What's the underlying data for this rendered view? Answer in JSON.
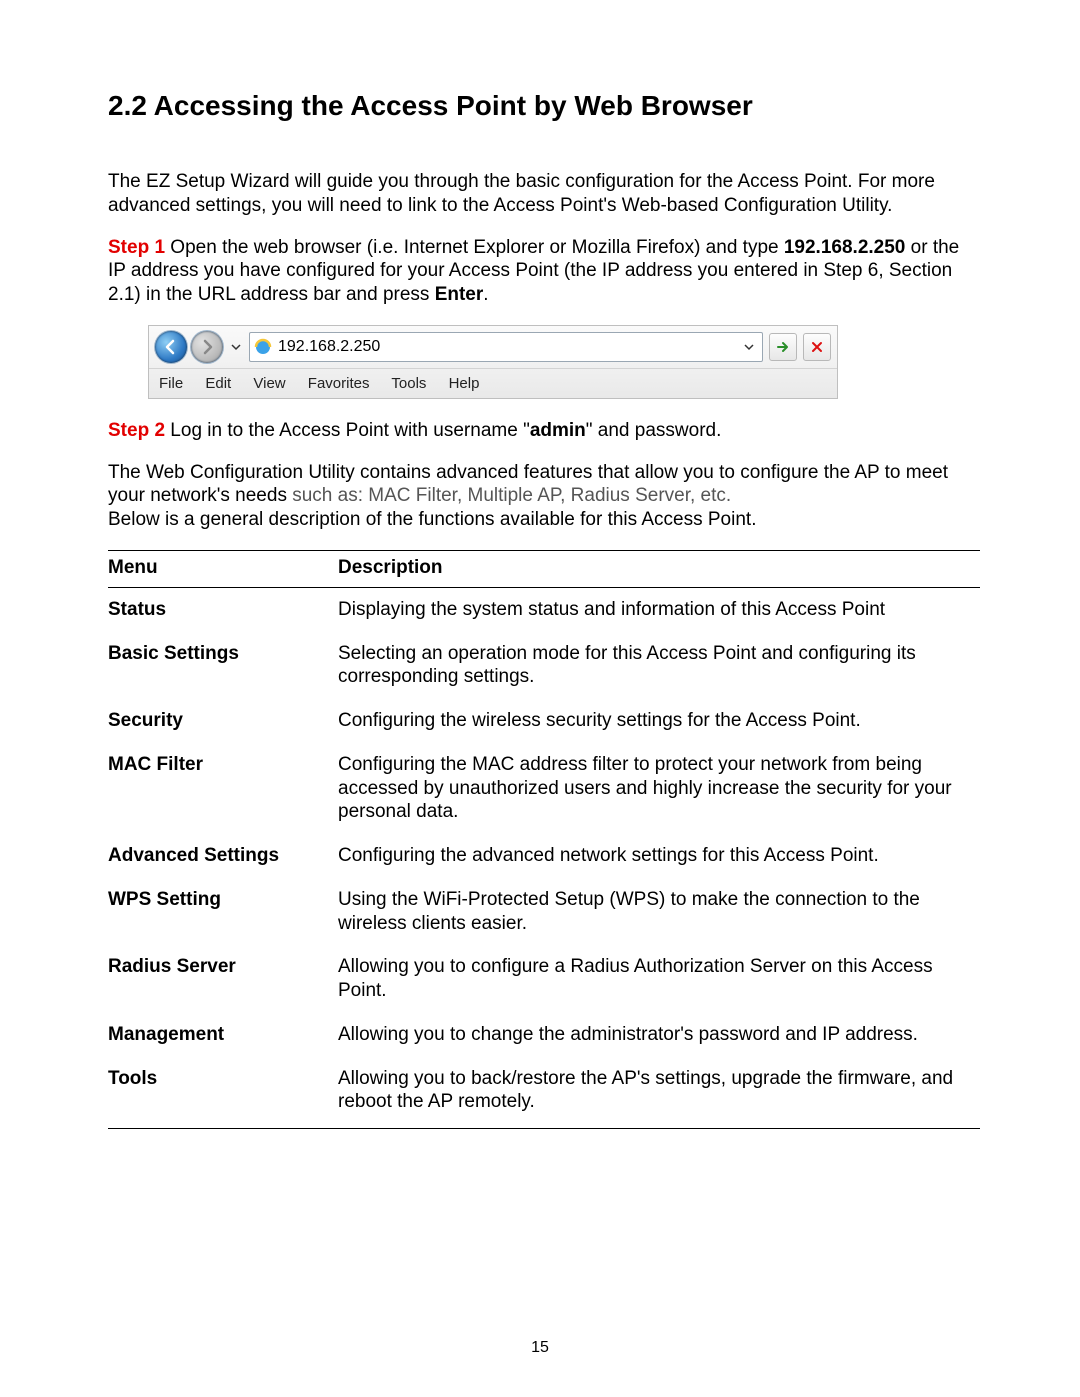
{
  "heading": "2.2 Accessing the Access Point by Web Browser",
  "intro": "The EZ Setup Wizard will guide you through the basic configuration for the Access Point. For more advanced settings, you will need to link to the Access Point's Web-based Configuration Utility.",
  "step1": {
    "label": "Step 1",
    "text_a": " Open the web browser (i.e. Internet Explorer or Mozilla Firefox) and type ",
    "ip": "192.168.2.250",
    "text_b": " or the IP address you have configured for your Access Point (the IP address you entered in Step 6, Section 2.1) in the URL address bar and press ",
    "enter": "Enter",
    "period": "."
  },
  "browser": {
    "address_value": "192.168.2.250",
    "menu_file": "File",
    "menu_edit": "Edit",
    "menu_view": "View",
    "menu_favorites": "Favorites",
    "menu_tools": "Tools",
    "menu_help": "Help"
  },
  "step2": {
    "label": "Step 2",
    "text_a": " Log in to the Access Point with username \"",
    "admin": "admin",
    "text_b": "\" and password."
  },
  "para3_a": "The Web Configuration Utility contains advanced features that allow you to configure the AP to meet your network's needs ",
  "para3_gray": "such as: MAC Filter, Multiple AP, Radius Server, etc.",
  "para3_b": "Below is a general description of the functions available for this Access Point.",
  "table": {
    "header_menu": "Menu",
    "header_desc": "Description",
    "rows": [
      {
        "menu": "Status",
        "desc": "Displaying the system status and information of this Access Point"
      },
      {
        "menu": "Basic Settings",
        "desc": "Selecting an operation mode for this Access Point and configuring its corresponding settings."
      },
      {
        "menu": "Security",
        "desc": "Configuring the wireless security settings for the Access Point."
      },
      {
        "menu": "MAC Filter",
        "desc": "Configuring the MAC address filter to protect your network from being accessed by unauthorized users and highly increase the security for your personal data."
      },
      {
        "menu": "Advanced Settings",
        "desc": "Configuring the advanced network settings for this Access Point."
      },
      {
        "menu": "WPS Setting",
        "desc": "Using the WiFi-Protected Setup (WPS) to make the connection to the wireless clients easier."
      },
      {
        "menu": "Radius Server",
        "desc": "Allowing you to configure a Radius Authorization Server on this Access Point."
      },
      {
        "menu": "Management",
        "desc": "Allowing you to change the administrator's password and IP address."
      },
      {
        "menu": "Tools",
        "desc": "Allowing you to back/restore the AP's settings, upgrade the firmware, and reboot the AP remotely."
      }
    ]
  },
  "page_number": "15"
}
